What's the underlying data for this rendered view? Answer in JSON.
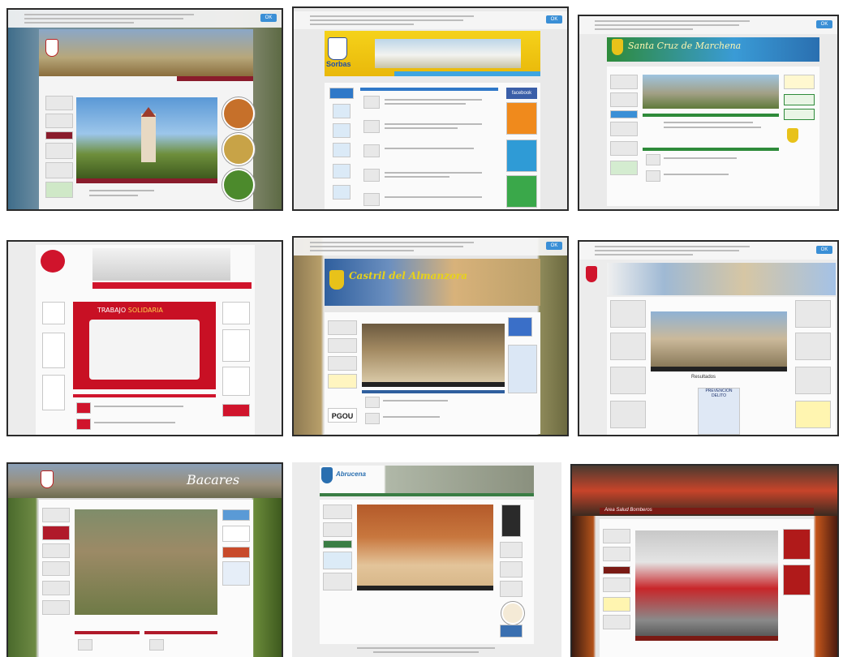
{
  "page": {
    "background": "#ffffff"
  },
  "thumbnails": [
    {
      "site_title": "",
      "accent": "#8a1c2c"
    },
    {
      "site_title": "Sorbas",
      "accent": "#e6c200"
    },
    {
      "site_title": "Santa Cruz de Marchena",
      "accent": "#2e8b3a"
    },
    {
      "site_title": "",
      "accent": "#d0142c"
    },
    {
      "site_title": "Castril del Almanzora",
      "accent": "#2f5f9e"
    },
    {
      "site_title": "",
      "accent": "#a4c2e6"
    },
    {
      "site_title": "Bacares",
      "accent": "#b01a2a"
    },
    {
      "site_title": "Abrucena",
      "accent": "#3a7d44"
    },
    {
      "site_title": "",
      "accent": "#7a1a14"
    }
  ],
  "labels": {
    "accept_button": "OK",
    "t2_video_label": "facebook",
    "t4_slide_title": "TRABAJO",
    "t4_slide_title2": "SOLIDARIA",
    "t6_section_title": "Resultados",
    "t6_poster_label": "PREVENCION DELITO",
    "t5_pgou": "PGOU",
    "t9_banner": "Area Salud Bomberos"
  }
}
